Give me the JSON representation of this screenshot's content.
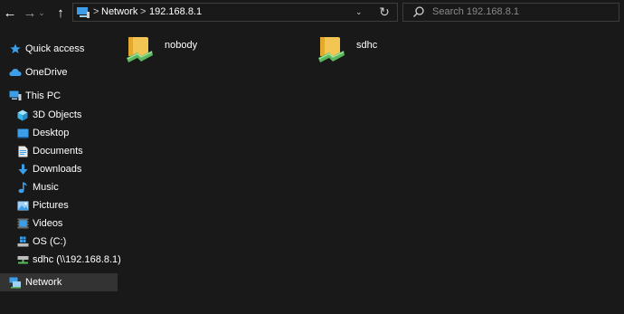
{
  "toolbar": {
    "back_glyph": "←",
    "forward_glyph": "→",
    "recent_glyph": "⌄",
    "up_glyph": "↑",
    "refresh_glyph": "↻"
  },
  "address": {
    "separator": ">",
    "crumbs": [
      "Network",
      "192.168.8.1"
    ],
    "dropdown_glyph": "⌄"
  },
  "search": {
    "placeholder": "Search 192.168.8.1"
  },
  "sidebar": {
    "items": [
      {
        "label": "Quick access",
        "icon": "star-icon"
      },
      {
        "label": "OneDrive",
        "icon": "cloud-icon"
      },
      {
        "label": "This PC",
        "icon": "computer-icon"
      },
      {
        "label": "3D Objects",
        "icon": "cube-icon"
      },
      {
        "label": "Desktop",
        "icon": "desktop-icon"
      },
      {
        "label": "Documents",
        "icon": "documents-icon"
      },
      {
        "label": "Downloads",
        "icon": "download-icon"
      },
      {
        "label": "Music",
        "icon": "music-icon"
      },
      {
        "label": "Pictures",
        "icon": "pictures-icon"
      },
      {
        "label": "Videos",
        "icon": "videos-icon"
      },
      {
        "label": "OS (C:)",
        "icon": "drive-icon"
      },
      {
        "label": "sdhc (\\\\192.168.8.1)",
        "icon": "network-drive-icon"
      },
      {
        "label": "Network",
        "icon": "network-icon"
      }
    ],
    "selected": "Network"
  },
  "content": {
    "items": [
      {
        "name": "nobody",
        "icon": "shared-folder-icon"
      },
      {
        "name": "sdhc",
        "icon": "shared-folder-icon"
      }
    ]
  },
  "colors": {
    "background": "#191919",
    "selection": "#333333",
    "accent_blue": "#3c9ee8",
    "folder_yellow": "#f3c654",
    "share_green": "#5cb85c"
  }
}
